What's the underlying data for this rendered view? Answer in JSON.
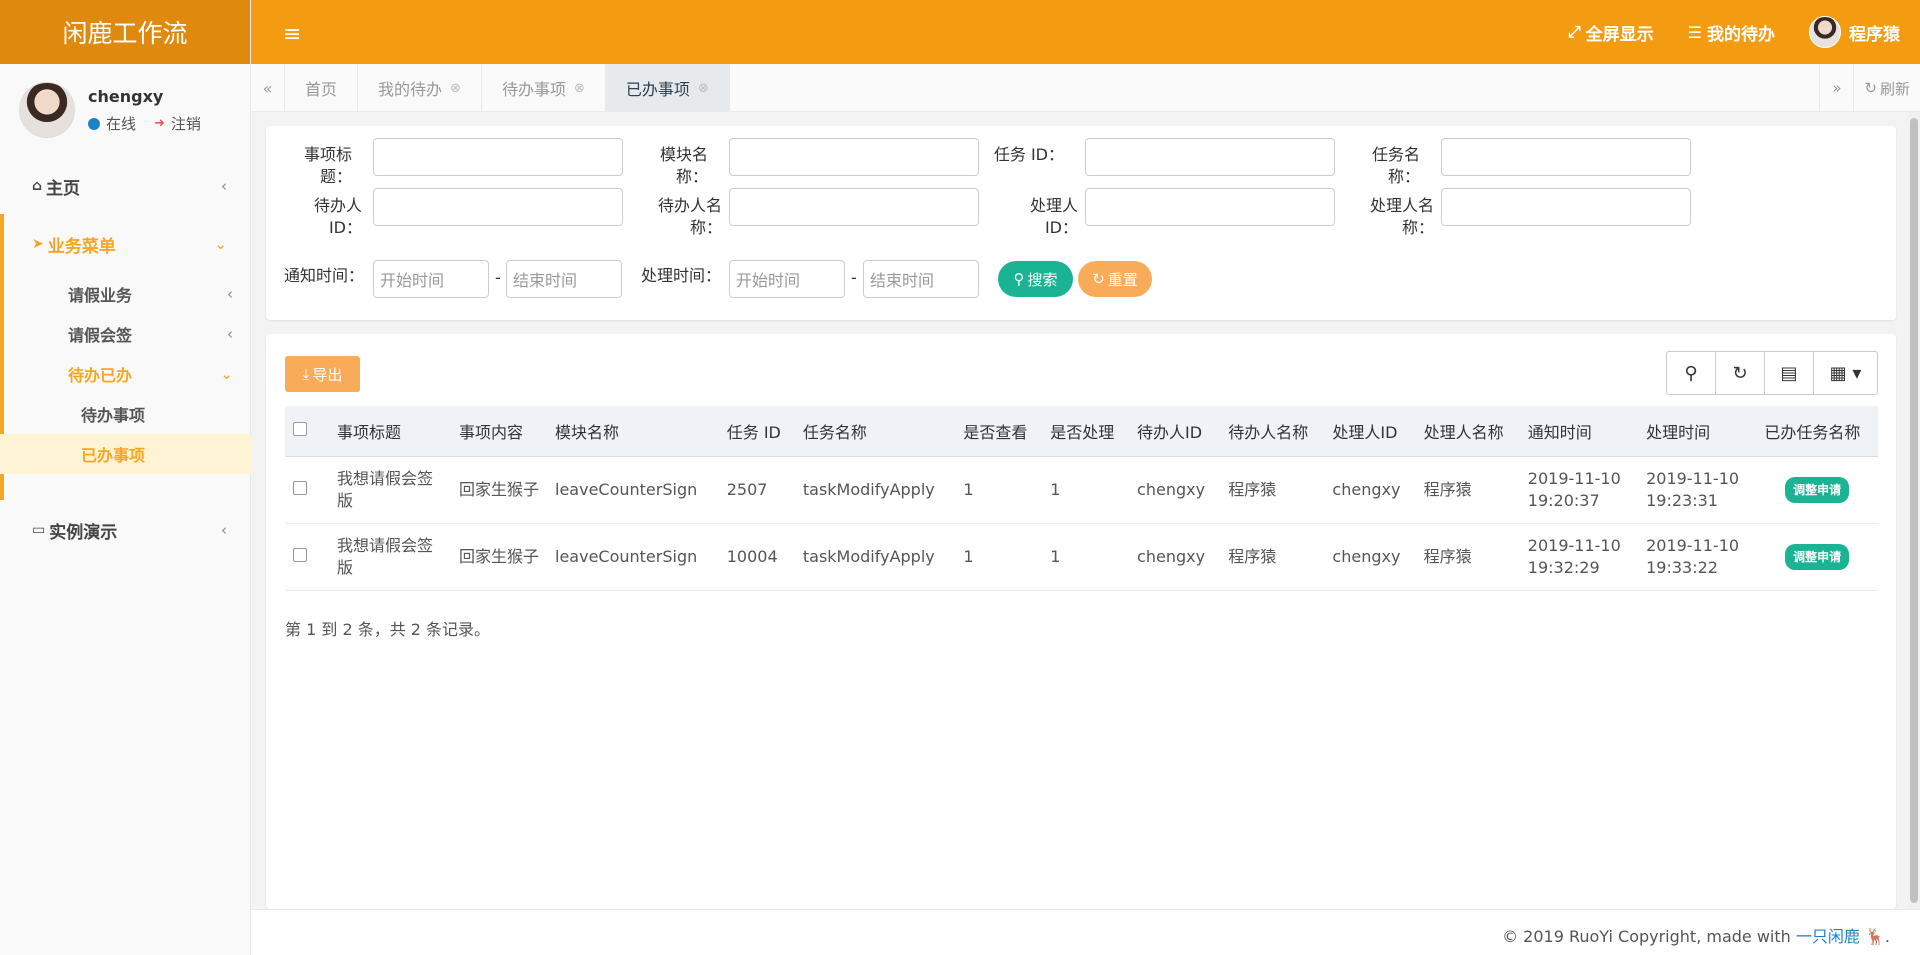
{
  "app": {
    "title": "闲鹿工作流"
  },
  "profile": {
    "username": "chengxy",
    "status": "在线",
    "logout": "注销"
  },
  "sidebar": {
    "home": "主页",
    "business_menu": "业务菜单",
    "leave": "请假业务",
    "leave_countersign": "请假会签",
    "todo_done": "待办已办",
    "todo_items": "待办事项",
    "done_items": "已办事项",
    "demo": "实例演示"
  },
  "header": {
    "fullscreen": "全屏显示",
    "my_todo": "我的待办",
    "user": "程序猿"
  },
  "tabs": [
    {
      "label": "首页"
    },
    {
      "label": "我的待办"
    },
    {
      "label": "待办事项"
    },
    {
      "label": "已办事项"
    }
  ],
  "refresh": "刷新",
  "search": {
    "labels": {
      "title": "事项标题：",
      "module": "模块名称：",
      "task_id": "任务 ID：",
      "task_name": "任务名称：",
      "todo_user_id_1": "待办人",
      "todo_user_id_2": "ID：",
      "todo_user_name_1": "待办人名",
      "todo_user_name_2": "称：",
      "handler_id_1": "处理人",
      "handler_id_2": "ID：",
      "handler_name_1": "处理人名",
      "handler_name_2": "称：",
      "notify_time": "通知时间：",
      "handle_time": "处理时间："
    },
    "start_placeholder": "开始时间",
    "end_placeholder": "结束时间",
    "dash": "-",
    "search_button": "搜索",
    "reset_button": "重置"
  },
  "table": {
    "export_button": "导出",
    "columns": [
      "事项标题",
      "事项内容",
      "模块名称",
      "任务 ID",
      "任务名称",
      "是否查看",
      "是否处理",
      "待办人ID",
      "待办人名称",
      "处理人ID",
      "处理人名称",
      "通知时间",
      "处理时间",
      "已办任务名称"
    ],
    "rows": [
      {
        "title": "我想请假会签版",
        "content": "回家生猴子",
        "module": "leaveCounterSign",
        "task_id": "2507",
        "task_name": "taskModifyApply",
        "viewed": "1",
        "handled": "1",
        "todo_user_id": "chengxy",
        "todo_user_name": "程序猿",
        "handler_id": "chengxy",
        "handler_name": "程序猿",
        "notify_date": "2019-11-10",
        "notify_time": "19:20:37",
        "handle_date": "2019-11-10",
        "handle_time": "19:23:31",
        "done_task": "调整申请"
      },
      {
        "title": "我想请假会签版",
        "content": "回家生猴子",
        "module": "leaveCounterSign",
        "task_id": "10004",
        "task_name": "taskModifyApply",
        "viewed": "1",
        "handled": "1",
        "todo_user_id": "chengxy",
        "todo_user_name": "程序猿",
        "handler_id": "chengxy",
        "handler_name": "程序猿",
        "notify_date": "2019-11-10",
        "notify_time": "19:32:29",
        "handle_date": "2019-11-10",
        "handle_time": "19:33:22",
        "done_task": "调整申请"
      }
    ],
    "pager": "第 1 到 2 条，共 2 条记录。"
  },
  "footer": {
    "text": "© 2019 RuoYi Copyright, made with ",
    "link": "一只闲鹿"
  },
  "colors": {
    "brand": "#f39c12",
    "accent": "#f5a623",
    "success": "#1ab394",
    "warning": "#f8ac59"
  }
}
